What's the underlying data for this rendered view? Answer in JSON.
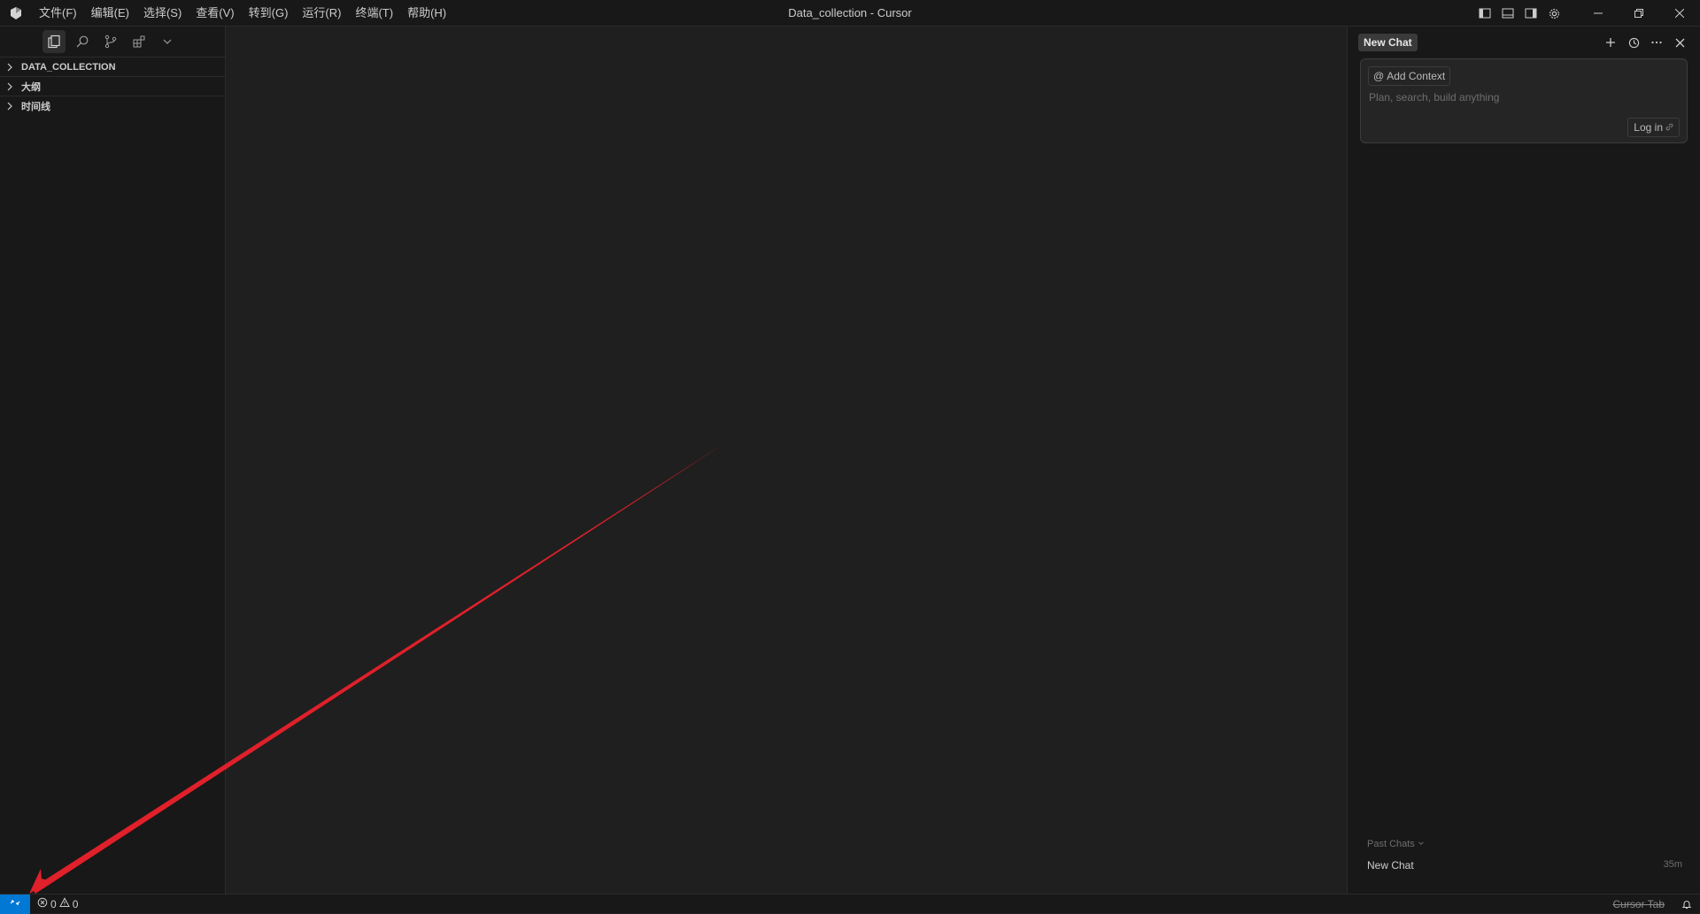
{
  "titlebar": {
    "menus": [
      "文件(F)",
      "编辑(E)",
      "选择(S)",
      "查看(V)",
      "转到(G)",
      "运行(R)",
      "终端(T)",
      "帮助(H)"
    ],
    "window_title": "Data_collection - Cursor"
  },
  "sidebar": {
    "sections": [
      "DATA_COLLECTION",
      "大纲",
      "时间线"
    ]
  },
  "chat": {
    "tab_label": "New Chat",
    "add_context_label": "Add Context",
    "placeholder": "Plan, search, build anything",
    "login_label": "Log in",
    "past_chats_label": "Past Chats",
    "past_items": [
      {
        "title": "New Chat",
        "time": "35m"
      }
    ]
  },
  "statusbar": {
    "errors": "0",
    "warnings": "0",
    "cursor_tab": "Cursor Tab"
  },
  "colors": {
    "annotation_arrow": "#e0202a",
    "remote_button": "#0078d4"
  }
}
